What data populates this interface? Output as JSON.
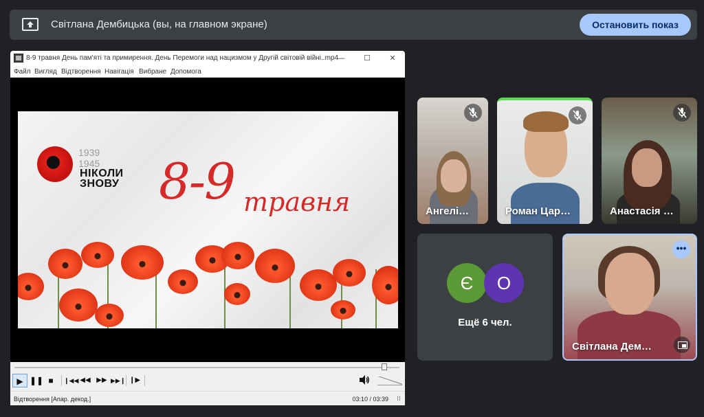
{
  "presenting_bar": {
    "text": "Світлана Дембицька (вы, на главном экране)",
    "stop_button": "Остановить показ"
  },
  "player": {
    "title": "8-9 травня День пам'яті та примирення. День Перемоги над нацизмом у Другій світовій війні..mp4",
    "window_controls": [
      "—",
      "☐",
      "✕"
    ],
    "menu": [
      "Файл",
      "Вигляд",
      "Відтворення",
      "Навігація",
      "Вибране",
      "Допомога"
    ],
    "video": {
      "years_line1": "1939",
      "years_line2": "1945",
      "slogan_line1": "НІКОЛИ",
      "slogan_line2": "ЗНОВУ",
      "date": "8-9",
      "month": "травня"
    },
    "progress_fraction": 0.96,
    "status": "Відтворення [Апар. декод.]",
    "time": "03:10 / 03:39"
  },
  "participants": [
    {
      "name": "Ангелі…",
      "muted": true
    },
    {
      "name": "Роман Цар…",
      "muted": true,
      "speaking": true
    },
    {
      "name": "Анастасія …",
      "muted": true
    }
  ],
  "overflow_tile": {
    "avatars": [
      {
        "letter": "Є",
        "color": "#5b9a36"
      },
      {
        "letter": "О",
        "color": "#5e35b1"
      }
    ],
    "label": "Ещё 6 чел."
  },
  "self_tile": {
    "name": "Світлана Дем…",
    "more_glyph": "•••"
  },
  "colors": {
    "background": "#202124",
    "accent": "#a8c7fa",
    "speaking": "#5ed857"
  }
}
